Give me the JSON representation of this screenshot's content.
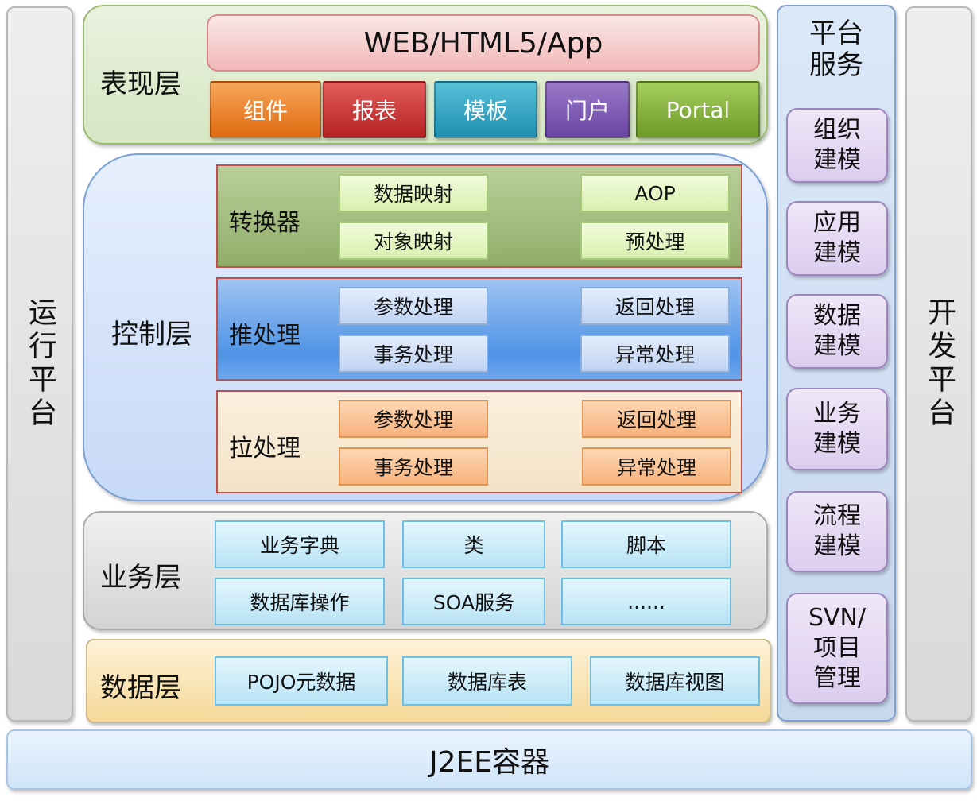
{
  "side_left": "运行平台",
  "side_right": "开发平台",
  "bottom": "J2EE容器",
  "presentation": {
    "label": "表现层",
    "top": "WEB/HTML5/App",
    "tiles": [
      "组件",
      "报表",
      "模板",
      "门户",
      "Portal"
    ]
  },
  "control": {
    "label": "控制层",
    "converter": {
      "label": "转换器",
      "cells": [
        "数据映射",
        "AOP",
        "对象映射",
        "预处理"
      ]
    },
    "push": {
      "label": "推处理",
      "cells": [
        "参数处理",
        "返回处理",
        "事务处理",
        "异常处理"
      ]
    },
    "pull": {
      "label": "拉处理",
      "cells": [
        "参数处理",
        "返回处理",
        "事务处理",
        "异常处理"
      ]
    }
  },
  "business": {
    "label": "业务层",
    "cells": [
      "业务字典",
      "类",
      "脚本",
      "数据库操作",
      "SOA服务",
      "......"
    ]
  },
  "data": {
    "label": "数据层",
    "cells": [
      "POJO元数据",
      "数据库表",
      "数据库视图"
    ]
  },
  "platform": {
    "title_line1": "平台",
    "title_line2": "服务",
    "items": [
      {
        "l1": "组织",
        "l2": "建模"
      },
      {
        "l1": "应用",
        "l2": "建模"
      },
      {
        "l1": "数据",
        "l2": "建模"
      },
      {
        "l1": "业务",
        "l2": "建模"
      },
      {
        "l1": "流程",
        "l2": "建模"
      },
      {
        "l1": "SVN/",
        "l2": "项目",
        "l3": "管理"
      }
    ]
  }
}
